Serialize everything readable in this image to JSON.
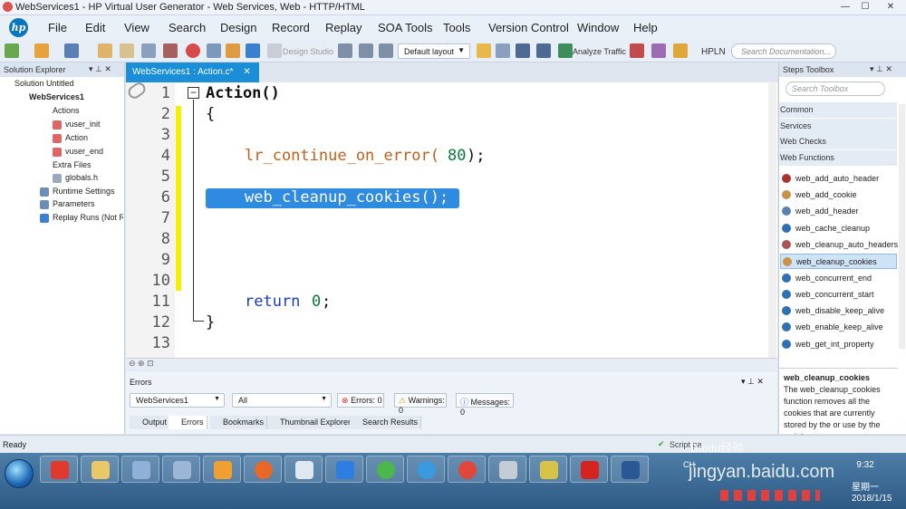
{
  "window": {
    "title": "WebServices1 - HP Virtual User Generator - Web Services, Web - HTTP/HTML"
  },
  "menu": [
    "File",
    "Edit",
    "View",
    "Search",
    "Design",
    "Record",
    "Replay",
    "SOA Tools",
    "Tools",
    "Version Control",
    "Window",
    "Help"
  ],
  "toolbar": {
    "design_studio": "Design Studio",
    "layout": "Default layout",
    "analyze_traffic": "Analyze Traffic",
    "hpln": "HPLN",
    "search_placeholder": "Search Documentation..."
  },
  "solution_explorer": {
    "title": "Solution Explorer",
    "items": [
      "Solution Untitled",
      "WebServices1",
      "Actions",
      "vuser_init",
      "Action",
      "vuser_end",
      "Extra Files",
      "globals.h",
      "Runtime Settings",
      "Parameters",
      "Replay Runs (Not Run"
    ]
  },
  "editor": {
    "tab": "WebServices1 : Action.c*",
    "line_numbers": [
      "1",
      "2",
      "3",
      "4",
      "5",
      "6",
      "7",
      "8",
      "9",
      "10",
      "11",
      "12",
      "13"
    ],
    "code": {
      "l1": "Action()",
      "l2": "{",
      "l4_func": "lr_continue_on_error(",
      "l4_num": "80",
      "l4_end": ");",
      "l6": "web_cleanup_cookies();",
      "l11_kw": "return",
      "l11_num": "0",
      "l11_end": ";",
      "l12": "}"
    }
  },
  "errors_panel": {
    "title": "Errors",
    "script_combo": "WebServices1",
    "filter_combo": "All",
    "errors": "Errors: 0",
    "warnings": "Warnings: 0",
    "messages": "Messages: 0"
  },
  "bottom_tabs": [
    "Output",
    "Errors",
    "Bookmarks",
    "Thumbnail Explorer",
    "Search Results"
  ],
  "steps_toolbox": {
    "title": "Steps Toolbox",
    "search_placeholder": "Search Toolbox",
    "categories": [
      "Common",
      "Services",
      "Web Checks",
      "Web Functions"
    ],
    "items": [
      "web_add_auto_header",
      "web_add_cookie",
      "web_add_header",
      "web_cache_cleanup",
      "web_cleanup_auto_headers",
      "web_cleanup_cookies",
      "web_concurrent_end",
      "web_concurrent_start",
      "web_disable_keep_alive",
      "web_enable_keep_alive",
      "web_get_int_property"
    ],
    "selected": "web_cleanup_cookies",
    "desc_title": "web_cleanup_cookies",
    "desc_text": "The web_cleanup_cookies function removes all the cookies that are currently stored by the or use by the script."
  },
  "status": {
    "left": "Ready",
    "right": "Script pa"
  },
  "taskbar": {
    "clock": "9:32",
    "weekday": "星期一",
    "date": "2018/1/15",
    "lang": "CH"
  },
  "watermark": {
    "brand": "Baidu经验",
    "site": "jingyan.baidu.com"
  }
}
